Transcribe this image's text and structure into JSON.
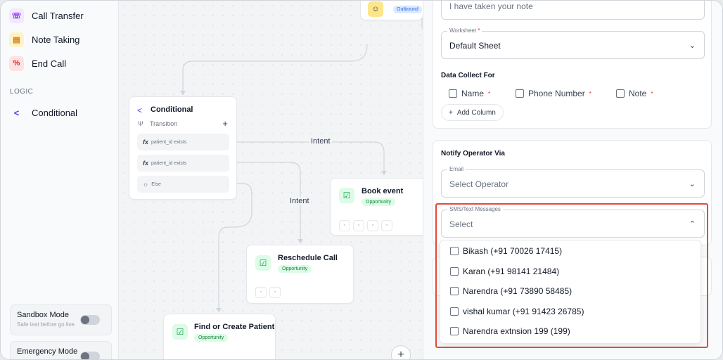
{
  "sidebar": {
    "items": [
      {
        "label": "Call Transfer",
        "icon": "phone-transfer-icon"
      },
      {
        "label": "Note Taking",
        "icon": "note-icon"
      },
      {
        "label": "End Call",
        "icon": "end-call-icon"
      }
    ],
    "logic_label": "LOGIC",
    "logic_items": [
      {
        "label": "Conditional",
        "icon": "branch-icon"
      }
    ],
    "sandbox": {
      "title": "Sandbox Mode",
      "subtitle": "Safe test before go live"
    },
    "emergency": {
      "title": "Emergency Mode",
      "subtitle": ""
    }
  },
  "canvas": {
    "top_node_badge": "Outbound",
    "conditional": {
      "title": "Conditional",
      "transition_label": "Transition",
      "rows": [
        "patient_id exists",
        "patient_id exists",
        "Else"
      ]
    },
    "intent_labels": [
      "Intent",
      "Intent"
    ],
    "book_event": {
      "title": "Book event",
      "badge": "Opportunity"
    },
    "reschedule": {
      "title": "Reschedule Call",
      "badge": "Opportunity"
    },
    "find_patient": {
      "title": "Find or Create Patient",
      "badge": "Opportunity"
    }
  },
  "panel": {
    "top_field_value": "I have taken your note",
    "worksheet": {
      "legend": "Worksheet",
      "value": "Default Sheet"
    },
    "data_collect": {
      "heading": "Data Collect For",
      "columns": [
        "Name",
        "Phone Number",
        "Note"
      ],
      "add_label": "Add Column"
    },
    "notify": {
      "heading": "Notify Operator Via",
      "email": {
        "legend": "Email",
        "placeholder": "Select Operator"
      },
      "sms": {
        "legend": "SMS/Text Messages",
        "placeholder": "Select"
      },
      "options": [
        "Bikash (+91 70026 17415)",
        "Karan (+91 98141 21484)",
        "Narendra (+91 73890 58485)",
        "vishal kumar (+91 91423 26785)",
        "Narendra extnsion 199 (199)"
      ]
    }
  },
  "colors": {
    "highlight": "#e04a3a",
    "opportunity": "#15803d",
    "accent": "#4f46e5"
  }
}
